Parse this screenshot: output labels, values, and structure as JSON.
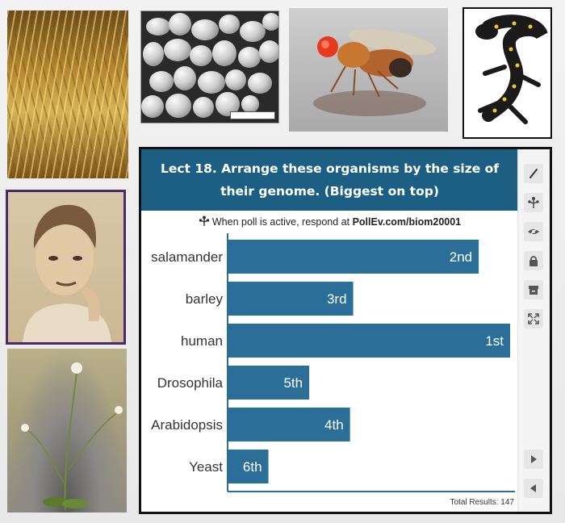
{
  "poll": {
    "title": "Lect 18. Arrange these organisms by the size of their genome. (Biggest on top)",
    "respond_prefix": "When poll is active, respond at ",
    "respond_url": "PollEv.com/biom20001",
    "total_results": "Total Results: 147"
  },
  "chart_data": {
    "type": "bar",
    "orientation": "horizontal",
    "categories": [
      "salamander",
      "barley",
      "human",
      "Drosophila",
      "Arabidopsis",
      "Yeast"
    ],
    "values": [
      80,
      40,
      90,
      26,
      39,
      13
    ],
    "value_labels": [
      "2nd",
      "3rd",
      "1st",
      "5th",
      "4th",
      "6th"
    ],
    "xlim": [
      0,
      90
    ],
    "bar_color": "#2b6f99",
    "grid": false
  },
  "sidebar": {
    "icons": [
      "pencil-icon",
      "polleverywhere-tree-icon",
      "hide-eye-icon",
      "lock-icon",
      "archive-icon",
      "expand-icon",
      "next-arrow-icon",
      "prev-arrow-icon"
    ]
  },
  "images": {
    "barley": "barley-photo",
    "yeast": "yeast-sem-photo",
    "fly": "drosophila-photo",
    "salamander": "salamander-photo",
    "portrait": "portrait-photo",
    "arabidopsis": "arabidopsis-photo"
  }
}
